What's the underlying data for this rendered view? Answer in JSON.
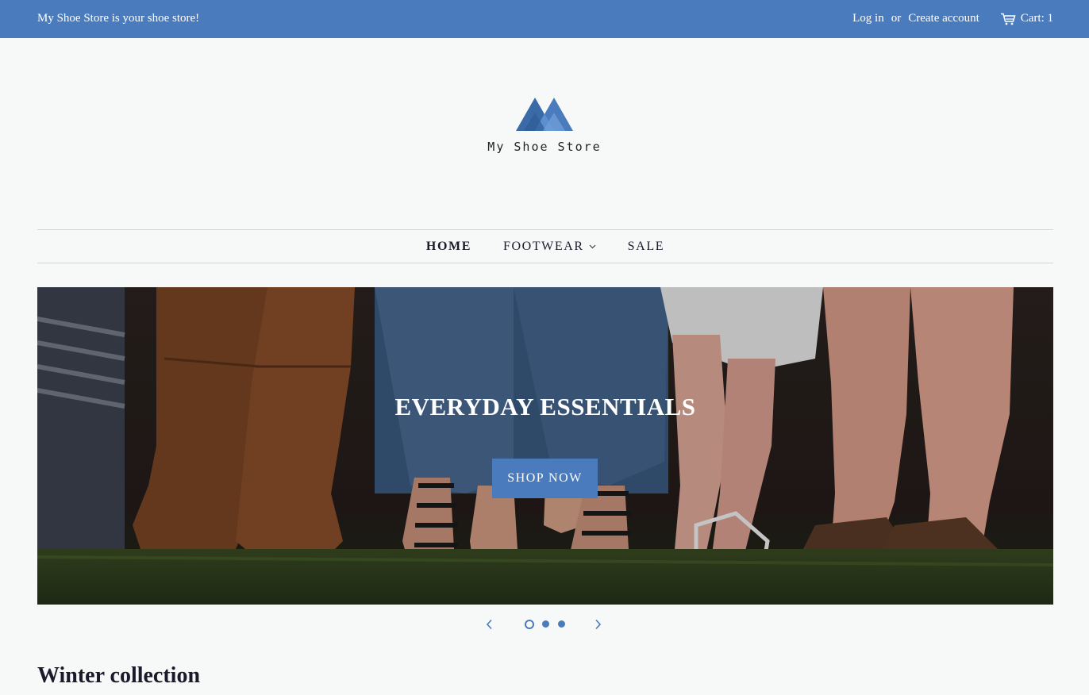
{
  "announcement": "My Shoe Store is your shoe store!",
  "account": {
    "login": "Log in",
    "or": "or",
    "create": "Create account",
    "cart": "Cart: 1",
    "cart_icon": "cart-icon"
  },
  "logo": {
    "icon": "mountain-logo-icon",
    "text": "My Shoe Store"
  },
  "nav": {
    "items": [
      {
        "label": "HOME",
        "active": true
      },
      {
        "label": "FOOTWEAR",
        "has_dropdown": true
      },
      {
        "label": "SALE"
      }
    ],
    "dropdown_icon": "chevron-down-icon"
  },
  "hero": {
    "title": "EVERYDAY ESSENTIALS",
    "button": "SHOP NOW"
  },
  "slider": {
    "slides": 3,
    "active_slide": 1,
    "prev_icon": "chevron-left-icon",
    "next_icon": "chevron-right-icon"
  },
  "section": {
    "title": "Winter collection"
  },
  "colors": {
    "accent": "#4a7bbd",
    "background": "#f7f8f8"
  }
}
